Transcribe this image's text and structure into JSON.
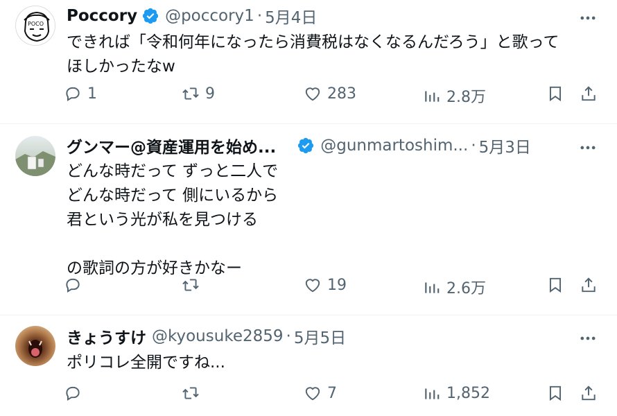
{
  "colors": {
    "text": "#0f1419",
    "secondary": "#536471",
    "verified": "#1d9bf0",
    "divider": "#eff3f4"
  },
  "tweets": [
    {
      "name": "Poccory",
      "handle": "@poccory1",
      "separator": "·",
      "date": "5月4日",
      "text": "できれば「令和何年になったら消費税はなくなるんだろう」と歌って\nほしかったなw",
      "replies": "1",
      "retweets": "9",
      "likes": "283",
      "views": "2.8万",
      "icons": [
        "reply-icon",
        "retweet-icon",
        "like-icon",
        "views-icon",
        "bookmark-icon",
        "share-icon"
      ]
    },
    {
      "name": "グンマー@資産運用を始め...",
      "handle": "@gunmartoshim...",
      "separator": "·",
      "date": "5月3日",
      "text": "どんな時だって ずっと二人で\nどんな時だって 側にいるから\n君という光が私を見つける\n\nの歌詞の方が好きかなー",
      "replies": "",
      "retweets": "",
      "likes": "19",
      "views": "2.6万"
    },
    {
      "name": "きょうすけ",
      "handle": "@kyousuke2859",
      "separator": "·",
      "date": "5月5日",
      "text": "ポリコレ全開ですね...",
      "replies": "",
      "retweets": "",
      "likes": "7",
      "views": "1,852"
    }
  ]
}
